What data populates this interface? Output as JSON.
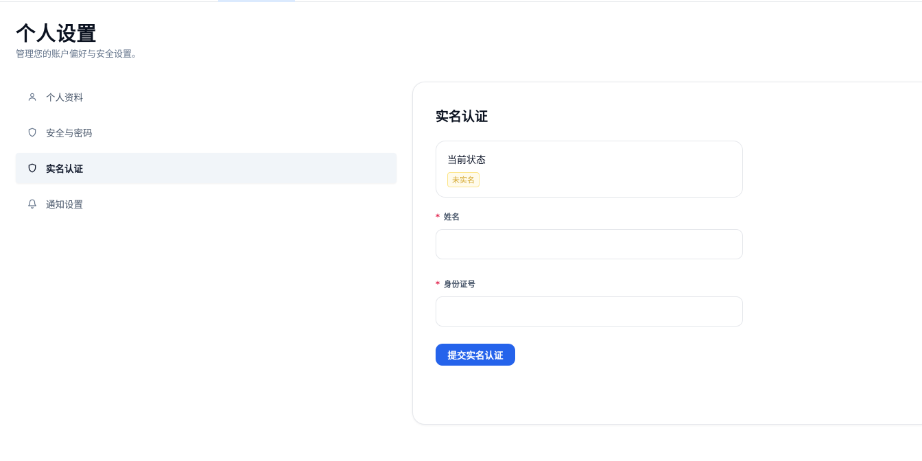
{
  "page": {
    "title": "个人设置",
    "subtitle": "管理您的账户偏好与安全设置。"
  },
  "sidebar": {
    "items": [
      {
        "label": "个人资料",
        "icon": "user-icon",
        "active": false
      },
      {
        "label": "安全与密码",
        "icon": "shield-icon",
        "active": false
      },
      {
        "label": "实名认证",
        "icon": "shield-icon",
        "active": true
      },
      {
        "label": "通知设置",
        "icon": "bell-icon",
        "active": false
      }
    ]
  },
  "verification": {
    "title": "实名认证",
    "status_label": "当前状态",
    "status_value": "未实名",
    "name_label": "姓名",
    "name_value": "",
    "id_label": "身份证号",
    "id_value": "",
    "required_mark": "*",
    "submit_label": "提交实名认证"
  },
  "colors": {
    "accent": "#2563eb",
    "status_warning": "#d4a72c",
    "required": "#e11d48",
    "active_bg": "#f1f5f9"
  }
}
